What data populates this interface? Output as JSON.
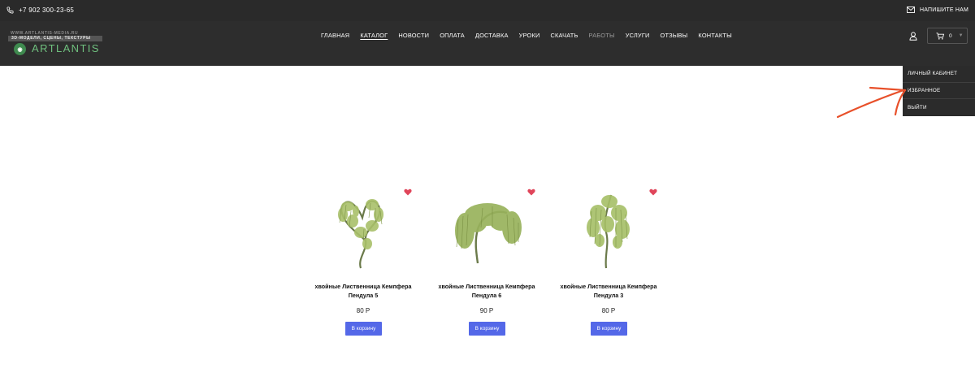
{
  "topbar": {
    "phone": "+7 902 300-23-65",
    "write_us": "НАПИШИТЕ НАМ",
    "phone_icon": "phone-icon",
    "mail_icon": "mail-icon"
  },
  "logo": {
    "tagline_top": "WWW.ARTLANTIS-MEDIA.RU",
    "tagline": "3D-МОДЕЛИ, СЦЕНЫ, ТЕКСТУРЫ",
    "brand": "ARTLANTIS"
  },
  "nav": {
    "items": [
      {
        "label": "ГЛАВНАЯ"
      },
      {
        "label": "КАТАЛОГ"
      },
      {
        "label": "НОВОСТИ"
      },
      {
        "label": "ОПЛАТА"
      },
      {
        "label": "ДОСТАВКА"
      },
      {
        "label": "УРОКИ"
      },
      {
        "label": "СКАЧАТЬ"
      },
      {
        "label": "РАБОТЫ"
      },
      {
        "label": "УСЛУГИ"
      },
      {
        "label": "ОТЗЫВЫ"
      },
      {
        "label": "КОНТАКТЫ"
      }
    ],
    "active": "КАТАЛОГ"
  },
  "cart": {
    "count": "0",
    "icon": "cart-icon"
  },
  "user_menu": {
    "items": [
      {
        "label": "ЛИЧНЫЙ КАБИНЕТ"
      },
      {
        "label": "ИЗБРАННОЕ"
      },
      {
        "label": "ВЫЙТИ"
      }
    ]
  },
  "colors": {
    "header_bg": "#2d2d2d",
    "accent_button": "#5468e8",
    "favorite": "#e0455a",
    "annotation_arrow": "#e8502a",
    "brand_green": "#6fbf7e"
  },
  "products": [
    {
      "title": "хвойные Лиственница Кемпфера Пендула 5",
      "price": "80 Р",
      "button": "В корзину"
    },
    {
      "title": "хвойные Лиственница Кемпфера Пендула 6",
      "price": "90 Р",
      "button": "В корзину"
    },
    {
      "title": "хвойные Лиственница Кемпфера Пендула 3",
      "price": "80 Р",
      "button": "В корзину"
    }
  ]
}
